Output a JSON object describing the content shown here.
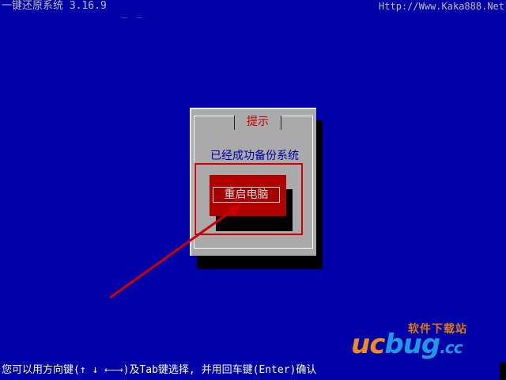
{
  "header": {
    "title": "一键还原系统 3.16.9",
    "cursor": "_ _",
    "url": "Http://Www.Kaka888.Net"
  },
  "dialog": {
    "title": "提示",
    "message": "已经成功备份系统",
    "button_label": "重启电脑"
  },
  "footer": {
    "help_text": "您可以用方向键(↑ ↓ ←—→)及Tab键选择, 并用回车键(Enter)确认"
  },
  "watermark": {
    "uc": "uc",
    "bug": "bug",
    "cc": ".cc",
    "cn": "软件下载站"
  },
  "colors": {
    "background": "#0000a8",
    "dialog": "#aaaaaa",
    "button": "#b00000",
    "annotation": "#d00000"
  }
}
